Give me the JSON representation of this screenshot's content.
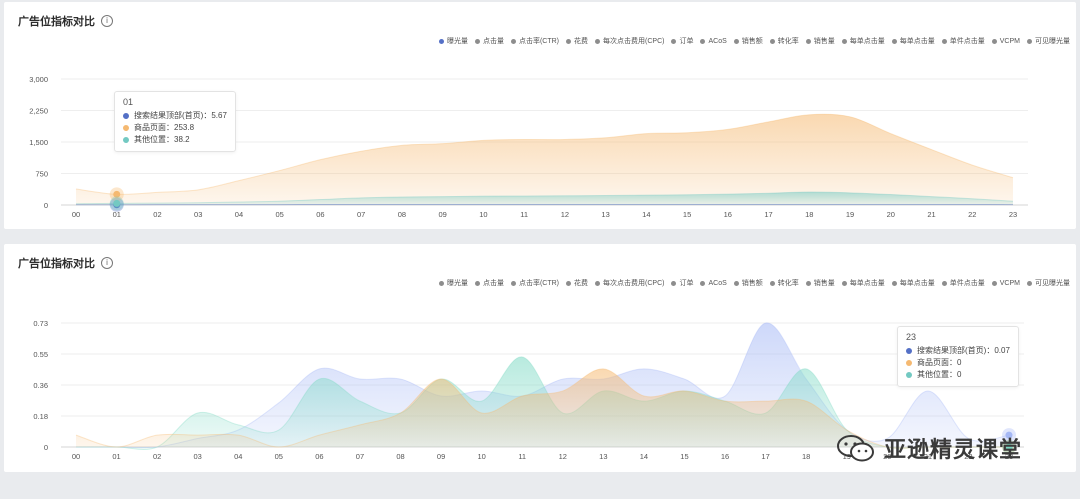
{
  "chart_data": [
    {
      "type": "area",
      "title": "广告位指标对比",
      "legend": [
        "曝光量",
        "点击量",
        "点击率(CTR)",
        "花费",
        "每次点击费用(CPC)",
        "订单",
        "ACoS",
        "销售额",
        "转化率",
        "销售量",
        "每单点击量",
        "每单点击量",
        "单件点击量",
        "VCPM",
        "可见曝光量"
      ],
      "legend_active_index": 0,
      "legend_placement": "top-right",
      "x": [
        "00",
        "01",
        "02",
        "03",
        "04",
        "05",
        "06",
        "07",
        "08",
        "09",
        "10",
        "11",
        "12",
        "13",
        "14",
        "15",
        "16",
        "17",
        "18",
        "19",
        "20",
        "21",
        "22",
        "23"
      ],
      "yticks": [
        "0",
        "750",
        "1,500",
        "2,250",
        "3,000"
      ],
      "ylim": [
        0,
        3000
      ],
      "grid": true,
      "series": [
        {
          "name": "搜索结果顶部(首页)",
          "color": "#5470c6",
          "values": [
            5,
            5.67,
            8,
            8,
            10,
            10,
            12,
            12,
            12,
            12,
            12,
            12,
            12,
            12,
            12,
            12,
            12,
            12,
            12,
            12,
            12,
            12,
            12,
            10
          ]
        },
        {
          "name": "商品页面",
          "color": "#f5b971",
          "values": [
            380,
            253.8,
            300,
            360,
            580,
            820,
            1080,
            1280,
            1420,
            1460,
            1540,
            1560,
            1560,
            1600,
            1700,
            1720,
            1800,
            1980,
            2150,
            2100,
            1700,
            1320,
            950,
            650
          ]
        },
        {
          "name": "其他位置",
          "color": "#73c9c2",
          "values": [
            30,
            38.2,
            45,
            55,
            70,
            90,
            130,
            170,
            190,
            200,
            210,
            215,
            220,
            225,
            235,
            245,
            260,
            280,
            310,
            290,
            250,
            200,
            150,
            90
          ]
        }
      ],
      "tooltip": {
        "title": "01",
        "rows": [
          {
            "label": "搜索结果顶部(首页)",
            "value": "5.67",
            "color": "#5470c6"
          },
          {
            "label": "商品页面",
            "value": "253.8",
            "color": "#f5b971"
          },
          {
            "label": "其他位置",
            "value": "38.2",
            "color": "#73c9c2"
          }
        ]
      }
    },
    {
      "type": "area",
      "title": "广告位指标对比",
      "legend": [
        "曝光量",
        "点击量",
        "点击率(CTR)",
        "花费",
        "每次点击费用(CPC)",
        "订单",
        "ACoS",
        "销售额",
        "转化率",
        "销售量",
        "每单点击量",
        "每单点击量",
        "单件点击量",
        "VCPM",
        "可见曝光量"
      ],
      "legend_active_index": -1,
      "legend_placement": "top-right",
      "x": [
        "00",
        "01",
        "02",
        "03",
        "04",
        "05",
        "06",
        "07",
        "08",
        "09",
        "10",
        "11",
        "12",
        "13",
        "14",
        "15",
        "16",
        "17",
        "18",
        "19",
        "20",
        "21",
        "22",
        "23"
      ],
      "yticks": [
        "0",
        "0.18",
        "0.36",
        "0.55",
        "0.73"
      ],
      "ylim": [
        0,
        0.73
      ],
      "grid": true,
      "series": [
        {
          "name": "搜索结果顶部(首页)",
          "color": "#a5b8f5",
          "values": [
            0,
            0,
            0,
            0.05,
            0.1,
            0.26,
            0.46,
            0.4,
            0.4,
            0.3,
            0.33,
            0.3,
            0.4,
            0.4,
            0.46,
            0.4,
            0.3,
            0.73,
            0.4,
            0.1,
            0.05,
            0.33,
            0.05,
            0.07
          ]
        },
        {
          "name": "商品页面",
          "color": "#f5b971",
          "values": [
            0.07,
            0,
            0.07,
            0.07,
            0.07,
            0,
            0.07,
            0.13,
            0.2,
            0.4,
            0.2,
            0.3,
            0.33,
            0.46,
            0.3,
            0.33,
            0.27,
            0.27,
            0.27,
            0.1,
            0,
            0,
            0,
            0
          ]
        },
        {
          "name": "其他位置",
          "color": "#7dd9c4",
          "values": [
            0,
            0,
            0,
            0.2,
            0.13,
            0.1,
            0.4,
            0.27,
            0.2,
            0.4,
            0.27,
            0.53,
            0.2,
            0.33,
            0.27,
            0.33,
            0.27,
            0.2,
            0.46,
            0.1,
            0,
            0,
            0,
            0
          ]
        }
      ],
      "tooltip": {
        "title": "23",
        "rows": [
          {
            "label": "搜索结果顶部(首页)",
            "value": "0.07",
            "color": "#5470c6"
          },
          {
            "label": "商品页面",
            "value": "0",
            "color": "#f5b971"
          },
          {
            "label": "其他位置",
            "value": "0",
            "color": "#73c9c2"
          }
        ]
      }
    }
  ],
  "watermark": {
    "text": "亚逊精灵课堂",
    "icon": "wechat-icon"
  }
}
